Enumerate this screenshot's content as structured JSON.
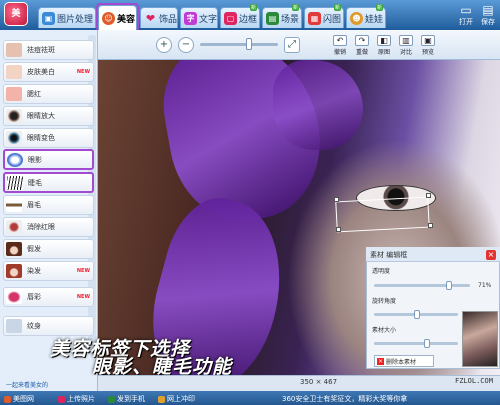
{
  "app": {
    "logo_text": "美"
  },
  "tabs": [
    {
      "label": "图片处理",
      "icon": "picture-icon",
      "color": "#3a8ad6"
    },
    {
      "label": "美容",
      "icon": "face-icon",
      "color": "#e05a2a",
      "active": true
    },
    {
      "label": "饰品",
      "icon": "heart-icon",
      "color": "#e0245e"
    },
    {
      "label": "文字",
      "icon": "text-icon",
      "color": "#c03ad6"
    },
    {
      "label": "边框",
      "icon": "frame-icon",
      "color": "#e0245e",
      "new": "新"
    },
    {
      "label": "场景",
      "icon": "scene-icon",
      "color": "#2a8a3a",
      "new": "新"
    },
    {
      "label": "闪图",
      "icon": "flash-icon",
      "color": "#e03a3a",
      "new": "新"
    },
    {
      "label": "娃娃",
      "icon": "doll-icon",
      "color": "#e09a2a",
      "new": "新"
    }
  ],
  "top_actions": [
    {
      "label": "打开",
      "icon": "open-icon"
    },
    {
      "label": "保存",
      "icon": "save-icon"
    }
  ],
  "sidebar": {
    "items": [
      {
        "label": "祛痘祛斑",
        "thumb": "#e7c1b0"
      },
      {
        "label": "皮肤美白",
        "thumb": "#f2d3c4",
        "badge": "NEW"
      },
      {
        "label": "腮红",
        "thumb": "#f3b3a8"
      },
      {
        "label": "眼睛放大",
        "thumb": "#6a4a3a"
      },
      {
        "label": "眼睛变色",
        "thumb": "#2d6a8a"
      },
      {
        "label": "眼影",
        "thumb": "#4a76d6",
        "selected": true
      },
      {
        "label": "睫毛",
        "thumb": "#222222",
        "selected": true
      },
      {
        "label": "眉毛",
        "thumb": "#7a5a3a"
      },
      {
        "label": "消除红眼",
        "thumb": "#b33a3a"
      },
      {
        "label": "假发",
        "thumb": "#5a2a1a"
      },
      {
        "label": "染发",
        "thumb": "#a03a2a",
        "badge": "NEW"
      },
      {
        "label": "唇彩",
        "thumb": "#d6336a",
        "badge": "NEW"
      },
      {
        "label": "纹身",
        "thumb": "#c9d6e6"
      }
    ],
    "footer": "一起来看美女的"
  },
  "toolbar": {
    "zoom_in": "+",
    "zoom_out": "−",
    "fit": "⤢",
    "buttons": [
      {
        "label": "撤销",
        "icon": "undo-icon"
      },
      {
        "label": "重做",
        "icon": "redo-icon"
      },
      {
        "label": "原图",
        "icon": "original-icon"
      },
      {
        "label": "对比",
        "icon": "compare-icon"
      },
      {
        "label": "预览",
        "icon": "preview-icon"
      }
    ]
  },
  "material_panel": {
    "title": "素材 编辑框",
    "opacity_label": "透明度",
    "opacity_value": "71%",
    "rotate_label": "旋转角度",
    "size_label": "素材大小",
    "delete_label": "删除本素材"
  },
  "status": {
    "dimensions": "350 × 467"
  },
  "caption": {
    "line1": "美容标签下选择",
    "line2": "眼影、睫毛功能"
  },
  "bottom_bar": [
    {
      "label": "美图网",
      "color": "#e05a2a"
    },
    {
      "label": "上传照片",
      "color": "#e0245e"
    },
    {
      "label": "发到手机",
      "color": "#2a8a3a"
    },
    {
      "label": "网上冲印",
      "color": "#e0a02a"
    }
  ],
  "bottom_notice": "360安全卫士有奖征文，精彩大奖等你拿",
  "watermark": "FZLOL.COM"
}
